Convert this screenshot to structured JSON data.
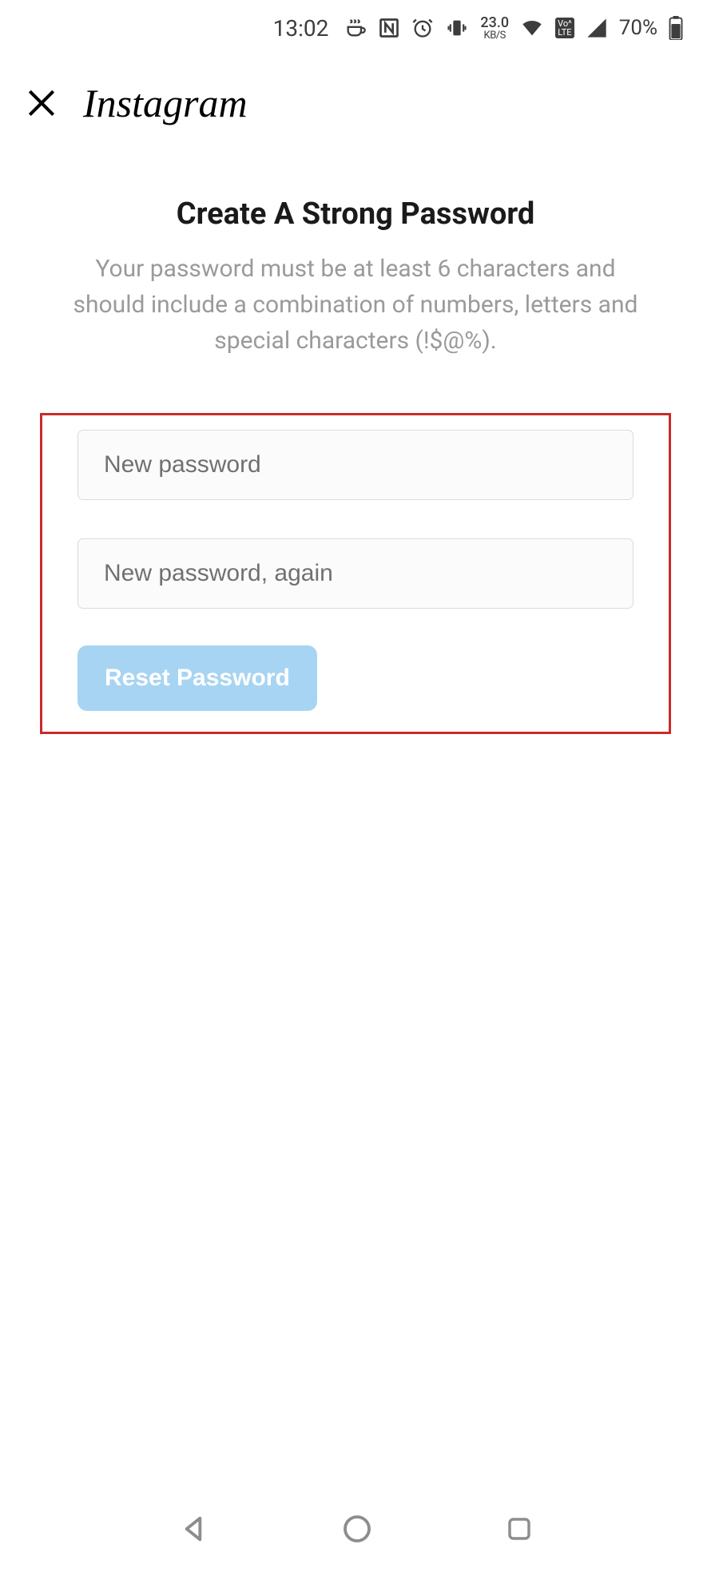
{
  "status_bar": {
    "time": "13:02",
    "data_rate_top": "23.0",
    "data_rate_bottom": "KB/S",
    "volte_top": "Vo^",
    "volte_bottom": "LTE",
    "battery_percent": "70%"
  },
  "header": {
    "logo_text": "Instagram"
  },
  "main": {
    "title": "Create A Strong Password",
    "subtitle": "Your password must be at least 6 characters and should include a combination of numbers, letters and special characters (!$@%)."
  },
  "form": {
    "new_password_placeholder": "New password",
    "new_password_value": "",
    "confirm_password_placeholder": "New password, again",
    "confirm_password_value": "",
    "reset_button_label": "Reset Password"
  }
}
